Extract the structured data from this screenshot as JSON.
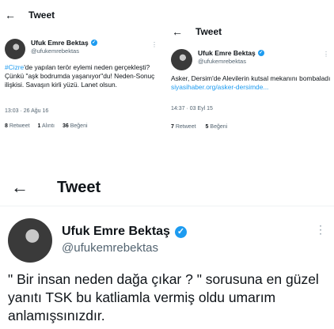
{
  "tweet1": {
    "header_title": "Tweet",
    "author_name": "Ufuk Emre Bektaş",
    "author_handle": "@ufukemrebektas",
    "hashtag": "#Cizre",
    "text": "'de yapılan terör eylemi neden gerçekleşti? Çünkü \"aşk bodrumda yaşanıyor\"du! Neden-Sonuç ilişkisi. Savaşın kirli yüzü. Lanet olsun.",
    "timestamp": "13:03 · 26 Ağu 16",
    "retweets_count": "8",
    "retweets_label": "Retweet",
    "quotes_count": "1",
    "quotes_label": "Alıntı",
    "likes_count": "36",
    "likes_label": "Beğeni"
  },
  "tweet2": {
    "header_title": "Tweet",
    "author_name": "Ufuk Emre Bektaş",
    "author_handle": "@ufukemrebektas",
    "text": "Asker, Dersim'de Alevilerin kutsal mekanını bombaladı ",
    "link_text": "siyasihaber.org/asker-dersimde...",
    "timestamp": "14:37 · 03 Eyl 15",
    "retweets_count": "7",
    "retweets_label": "Retweet",
    "likes_count": "5",
    "likes_label": "Beğeni"
  },
  "tweet3": {
    "header_title": "Tweet",
    "author_name": "Ufuk Emre Bektaş",
    "author_handle": "@ufukemrebektas",
    "text": "\" Bir insan neden dağa çıkar ? \" sorusuna en güzel yanıtı TSK bu katliamla vermiş oldu umarım anlamışsınızdır."
  },
  "icons": {
    "back": "←",
    "verified": "✓",
    "more": "⋮"
  },
  "colors": {
    "accent": "#1d9bf0",
    "secondary_text": "#536471"
  }
}
